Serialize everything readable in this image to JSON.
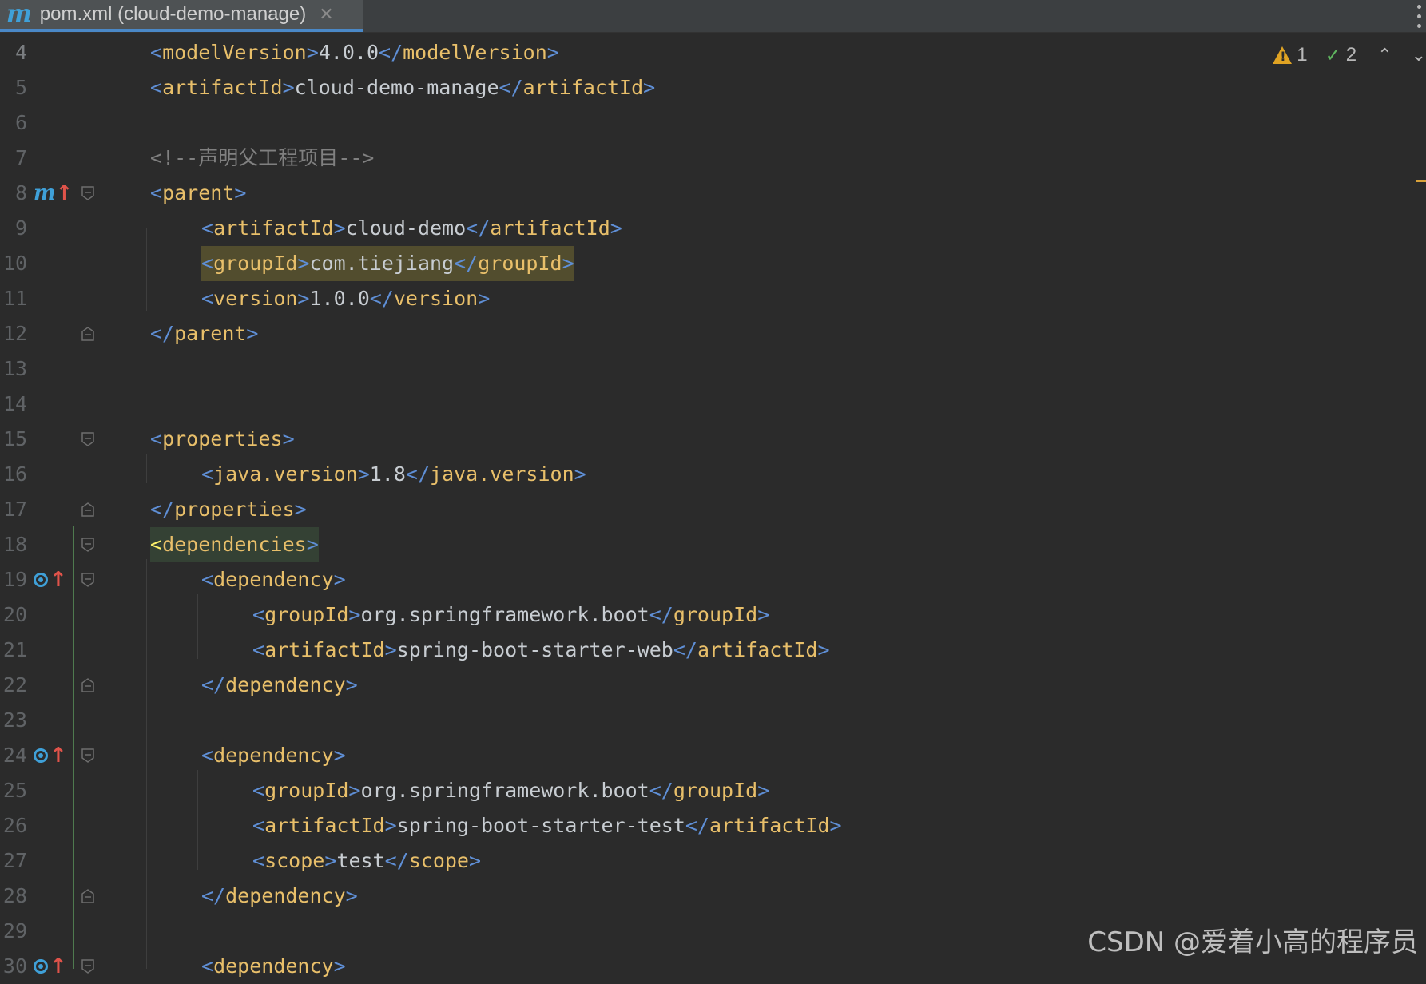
{
  "tab": {
    "icon": "maven-m-icon",
    "label": "pom.xml (cloud-demo-manage)",
    "close": "✕"
  },
  "inspections": {
    "warnings": "1",
    "weak_warnings": "2"
  },
  "lines": [
    {
      "n": "4"
    },
    {
      "n": "5"
    },
    {
      "n": "6"
    },
    {
      "n": "7"
    },
    {
      "n": "8"
    },
    {
      "n": "9"
    },
    {
      "n": "10"
    },
    {
      "n": "11"
    },
    {
      "n": "12"
    },
    {
      "n": "13"
    },
    {
      "n": "14"
    },
    {
      "n": "15"
    },
    {
      "n": "16"
    },
    {
      "n": "17"
    },
    {
      "n": "18"
    },
    {
      "n": "19"
    },
    {
      "n": "20"
    },
    {
      "n": "21"
    },
    {
      "n": "22"
    },
    {
      "n": "23"
    },
    {
      "n": "24"
    },
    {
      "n": "25"
    },
    {
      "n": "26"
    },
    {
      "n": "27"
    },
    {
      "n": "28"
    },
    {
      "n": "29"
    },
    {
      "n": "30"
    }
  ],
  "code": {
    "l4": {
      "tag": "modelVersion",
      "text": "4.0.0"
    },
    "l5": {
      "tag": "artifactId",
      "text": "cloud-demo-manage"
    },
    "l7": {
      "comment": "<!--声明父工程项目-->"
    },
    "l8": {
      "tag": "parent"
    },
    "l9": {
      "tag": "artifactId",
      "text": "cloud-demo"
    },
    "l10": {
      "tag": "groupId",
      "text": "com.tiejiang"
    },
    "l11": {
      "tag": "version",
      "text": "1.0.0"
    },
    "l12": {
      "tag": "parent"
    },
    "l15": {
      "tag": "properties"
    },
    "l16": {
      "tag": "java.version",
      "text": "1.8"
    },
    "l17": {
      "tag": "properties"
    },
    "l18": {
      "tag": "dependencies"
    },
    "l19": {
      "tag": "dependency"
    },
    "l20": {
      "tag": "groupId",
      "text": "org.springframework.boot"
    },
    "l21": {
      "tag": "artifactId",
      "text": "spring-boot-starter-web"
    },
    "l22": {
      "tag": "dependency"
    },
    "l24": {
      "tag": "dependency"
    },
    "l25": {
      "tag": "groupId",
      "text": "org.springframework.boot"
    },
    "l26": {
      "tag": "artifactId",
      "text": "spring-boot-starter-test"
    },
    "l27": {
      "tag": "scope",
      "text": "test"
    },
    "l28": {
      "tag": "dependency"
    },
    "l30": {
      "tag": "dependency"
    }
  },
  "watermark": "CSDN @爱着小高的程序员",
  "colors": {
    "background": "#2b2b2b",
    "tag": "#e8bf6a",
    "bracket": "#5f8fd6",
    "comment": "#808080",
    "accent": "#4a88c7"
  }
}
